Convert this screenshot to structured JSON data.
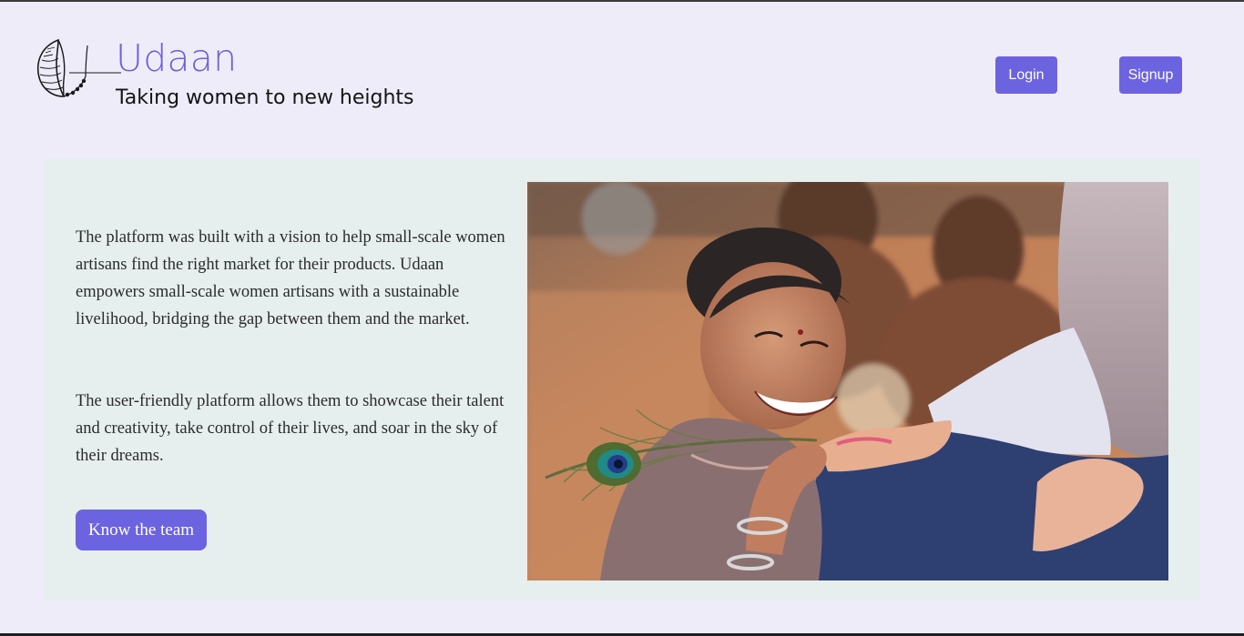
{
  "header": {
    "brand_name": "Udaan",
    "tagline": "Taking women to new heights",
    "login_label": "Login",
    "signup_label": "Signup"
  },
  "about": {
    "paragraph_1": "The platform was built with a vision to help small-scale women artisans find the right market for their products. Udaan empowers small-scale women artisans with a sustainable livelihood, bridging the gap between them and the market.",
    "paragraph_2": "The user-friendly platform allows them to showcase their talent and creativity, take control of their lives, and soar in the sky of their dreams.",
    "cta_label": "Know the team",
    "image_icon": "photo-girl-with-peacock-feather"
  },
  "colors": {
    "page_bg": "#efecf9",
    "accent": "#6c63e0",
    "brand_text": "#6c63d8",
    "card_bg": "#e6eeee"
  }
}
